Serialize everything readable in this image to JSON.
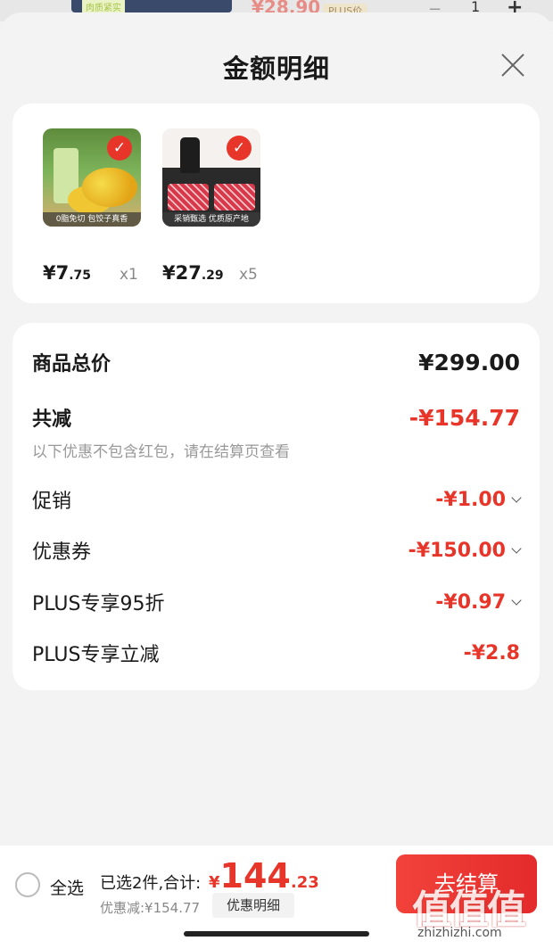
{
  "background": {
    "thumb_tag": "肉质紧实",
    "price": "¥28.90",
    "badge": "PLUS价",
    "minus": "−",
    "qty": "1",
    "plus": "+"
  },
  "sheet": {
    "title": "金额明细",
    "close_icon": "close-icon"
  },
  "products": [
    {
      "caption": "0脂免切 包饺子真香",
      "price_int": "¥7",
      "price_dec": ".75",
      "qty": "x1",
      "checked": "✓"
    },
    {
      "caption": "采销甄选 优质原产地",
      "price_int": "¥27",
      "price_dec": ".29",
      "qty": "x5",
      "checked": "✓"
    }
  ],
  "breakdown": {
    "total_label": "商品总价",
    "total_value": "¥299.00",
    "reduce_label": "共减",
    "reduce_value": "-¥154.77",
    "note": "以下优惠不包含红包，请在结算页查看",
    "rows": [
      {
        "label": "促销",
        "value": "-¥1.00"
      },
      {
        "label": "优惠券",
        "value": "-¥150.00"
      },
      {
        "label": "PLUS专享95折",
        "value": "-¥0.97"
      },
      {
        "label": "PLUS专享立减",
        "value": "-¥2.8"
      }
    ]
  },
  "bottom": {
    "select_all": "全选",
    "selected_text": "已选2件,合计:",
    "total_yen": "¥",
    "total_int": "144",
    "total_dec": ".23",
    "discount_text": "优惠减:¥154.77",
    "detail_button": "优惠明细",
    "checkout_button": "去结算"
  },
  "watermark": {
    "text": "值值值",
    "url": "zhizhizhi.com"
  },
  "colors": {
    "accent": "#e8352a",
    "background": "#f3f3f3"
  }
}
